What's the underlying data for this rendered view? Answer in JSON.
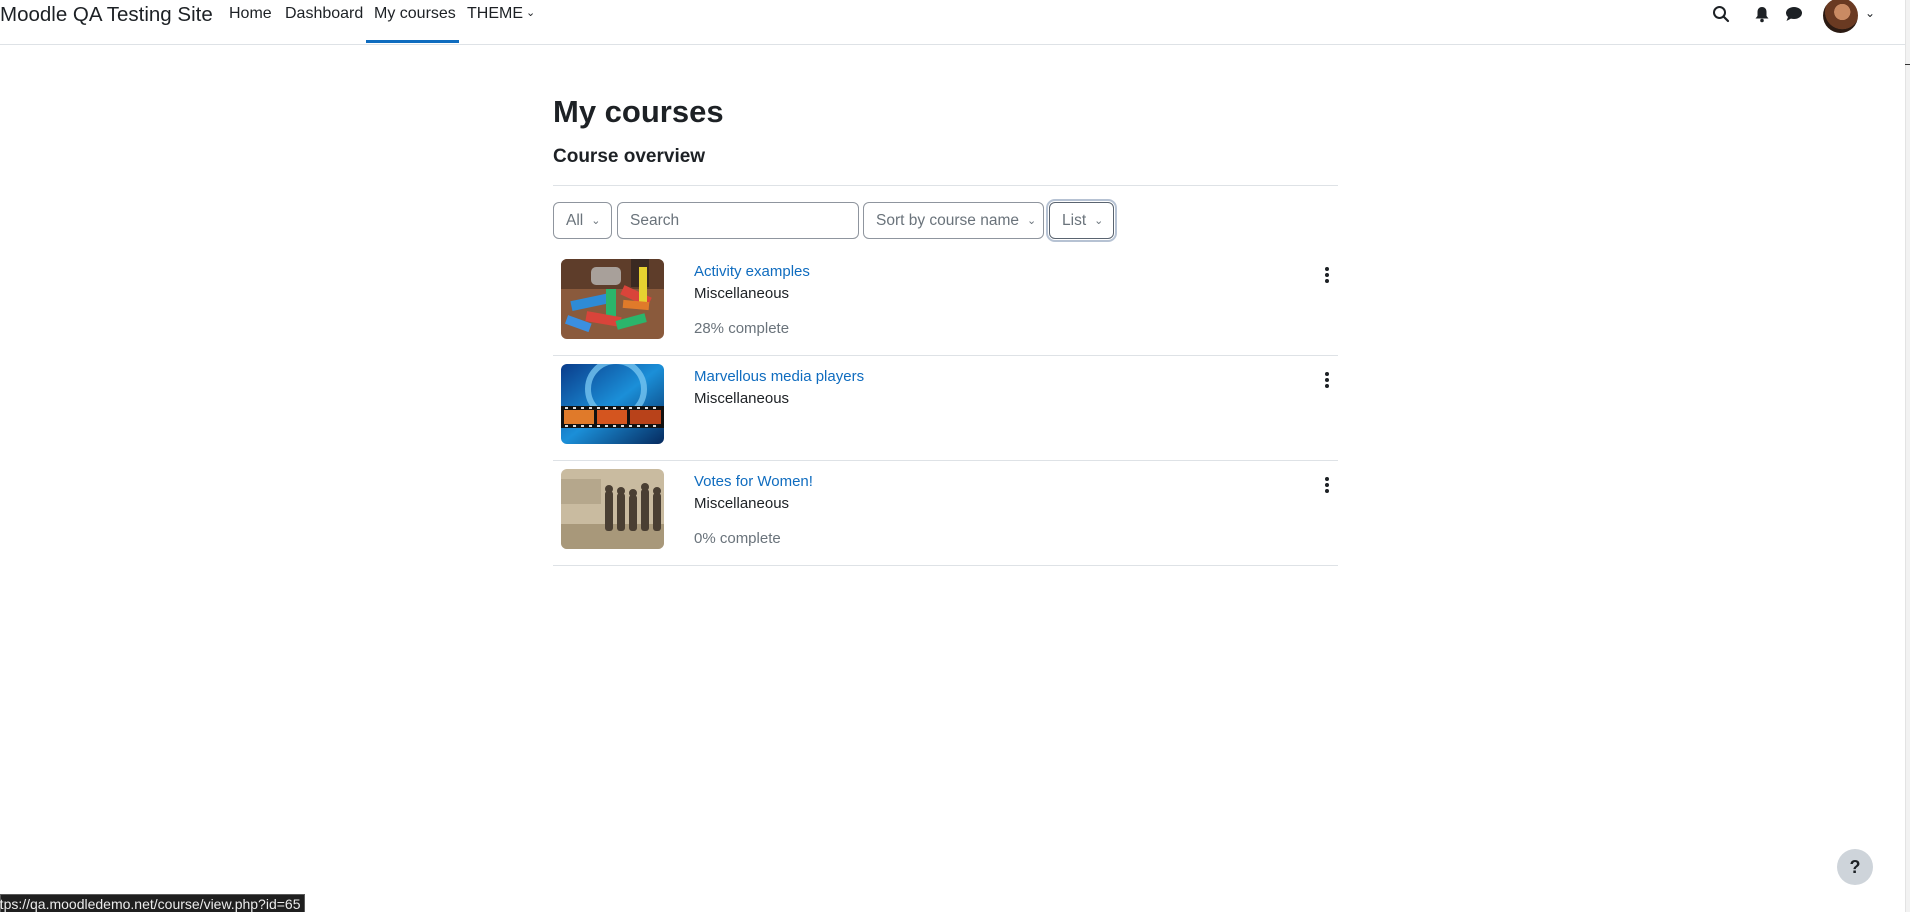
{
  "nav": {
    "site_name": "Moodle QA Testing Site",
    "items": [
      {
        "label": "Home"
      },
      {
        "label": "Dashboard"
      },
      {
        "label": "My courses",
        "active": true
      },
      {
        "label": "THEME"
      }
    ],
    "icons": [
      "search-icon",
      "bell-icon",
      "chat-icon",
      "avatar",
      "chevron-down-icon"
    ]
  },
  "main": {
    "page_title": "My courses",
    "block_title": "Course overview",
    "filters": {
      "grouping": "All",
      "search_placeholder": "Search",
      "sort": "Sort by course name",
      "view": "List"
    },
    "courses": [
      {
        "name": "Activity examples",
        "category": "Miscellaneous",
        "progress": "28% complete",
        "image": "coloured wooden blocks"
      },
      {
        "name": "Marvellous media players",
        "category": "Miscellaneous",
        "progress": "",
        "image": "film strip"
      },
      {
        "name": "Votes for Women!",
        "category": "Miscellaneous",
        "progress": "0% complete",
        "image": "sepia photo of women"
      }
    ]
  },
  "help_label": "?",
  "status_url": "https://qa.moodledemo.net/course/view.php?id=65",
  "colors": {
    "link": "#0f6cbf",
    "text": "#1d2125",
    "muted": "#6a737b",
    "border": "#dee2e6"
  }
}
